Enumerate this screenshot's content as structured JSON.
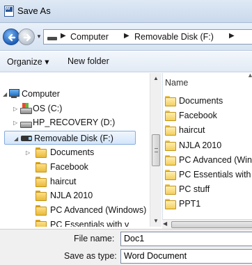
{
  "window": {
    "title": "Save As"
  },
  "address_bar": {
    "crumbs": [
      "Computer",
      "Removable Disk (F:)"
    ]
  },
  "toolbar": {
    "organize_label": "Organize ▾",
    "new_folder_label": "New folder"
  },
  "nav_tree": [
    {
      "label": "Computer",
      "icon": "computer-icon",
      "expander": "◢"
    },
    {
      "label": "OS (C:)",
      "icon": "windows-drive-icon",
      "expander": "▷"
    },
    {
      "label": "HP_RECOVERY (D:)",
      "icon": "hard-drive-icon",
      "expander": "▷"
    },
    {
      "label": "Removable Disk (F:)",
      "icon": "usb-drive-icon",
      "expander": "◢",
      "selected": true
    },
    {
      "label": "Documents",
      "icon": "folder-icon",
      "expander": "▷"
    },
    {
      "label": "Facebook",
      "icon": "folder-icon"
    },
    {
      "label": "haircut",
      "icon": "folder-icon"
    },
    {
      "label": "NJLA 2010",
      "icon": "folder-icon"
    },
    {
      "label": "PC Advanced (Windows)",
      "icon": "folder-icon"
    },
    {
      "label": "PC Essentials with v",
      "icon": "folder-icon"
    }
  ],
  "file_list": {
    "column_header": "Name",
    "items": [
      "Documents",
      "Facebook",
      "haircut",
      "NJLA 2010",
      "PC Advanced (Windows)",
      "PC Essentials with v",
      "PC stuff",
      "PPT1"
    ]
  },
  "form": {
    "file_name_label": "File name:",
    "file_name_value": "Doc1",
    "save_type_label": "Save as type:",
    "save_type_value": "Word Document"
  }
}
